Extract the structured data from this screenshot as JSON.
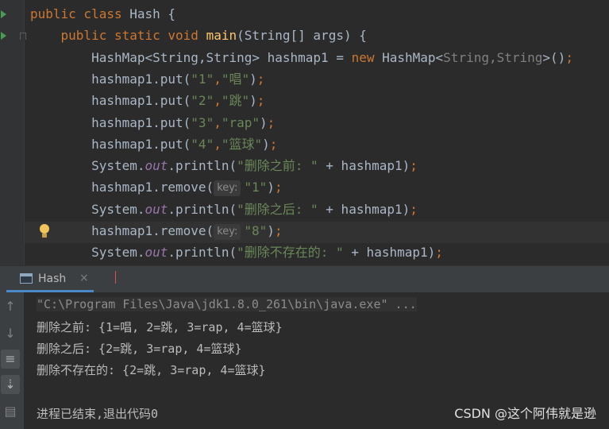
{
  "editor": {
    "lines": [
      {
        "indent": "",
        "parts": [
          [
            "kw",
            "public class "
          ],
          [
            "p",
            "Hash {"
          ]
        ]
      },
      {
        "indent": "    ",
        "parts": [
          [
            "kw",
            "public static void "
          ],
          [
            "fn",
            "main"
          ],
          [
            "p",
            "(String[] args) {"
          ]
        ]
      },
      {
        "indent": "        ",
        "parts": [
          [
            "p",
            "HashMap<String,String> hashmap1 = "
          ],
          [
            "kw",
            "new "
          ],
          [
            "p",
            "HashMap<"
          ],
          [
            "gen",
            "String,String"
          ],
          [
            "p",
            ">()"
          ],
          [
            "kw",
            ";"
          ]
        ]
      },
      {
        "indent": "        ",
        "parts": [
          [
            "p",
            "hashmap1.put("
          ],
          [
            "str",
            "\"1\""
          ],
          [
            "kw",
            ","
          ],
          [
            "str",
            "\"唱\""
          ],
          [
            "p",
            ")"
          ],
          [
            "kw",
            ";"
          ]
        ]
      },
      {
        "indent": "        ",
        "parts": [
          [
            "p",
            "hashmap1.put("
          ],
          [
            "str",
            "\"2\""
          ],
          [
            "kw",
            ","
          ],
          [
            "str",
            "\"跳\""
          ],
          [
            "p",
            ")"
          ],
          [
            "kw",
            ";"
          ]
        ]
      },
      {
        "indent": "        ",
        "parts": [
          [
            "p",
            "hashmap1.put("
          ],
          [
            "str",
            "\"3\""
          ],
          [
            "kw",
            ","
          ],
          [
            "str",
            "\"rap\""
          ],
          [
            "p",
            ")"
          ],
          [
            "kw",
            ";"
          ]
        ]
      },
      {
        "indent": "        ",
        "parts": [
          [
            "p",
            "hashmap1.put("
          ],
          [
            "str",
            "\"4\""
          ],
          [
            "kw",
            ","
          ],
          [
            "str",
            "\"篮球\""
          ],
          [
            "p",
            ")"
          ],
          [
            "kw",
            ";"
          ]
        ]
      },
      {
        "indent": "        ",
        "parts": [
          [
            "p",
            "System."
          ],
          [
            "field",
            "out"
          ],
          [
            "p",
            ".println("
          ],
          [
            "str",
            "\"删除之前: \""
          ],
          [
            "p",
            " + hashmap1)"
          ],
          [
            "kw",
            ";"
          ]
        ]
      },
      {
        "indent": "        ",
        "parts": [
          [
            "p",
            "hashmap1.remove("
          ],
          [
            "hint",
            "key:"
          ],
          [
            "str",
            "\"1\""
          ],
          [
            "p",
            ")"
          ],
          [
            "kw",
            ";"
          ]
        ]
      },
      {
        "indent": "        ",
        "parts": [
          [
            "p",
            "System."
          ],
          [
            "field",
            "out"
          ],
          [
            "p",
            ".println("
          ],
          [
            "str",
            "\"删除之后: \""
          ],
          [
            "p",
            " + hashmap1)"
          ],
          [
            "kw",
            ";"
          ]
        ]
      },
      {
        "indent": "        ",
        "parts": [
          [
            "p",
            "hashmap1.remove("
          ],
          [
            "hint",
            "key:"
          ],
          [
            "str",
            "\"8\""
          ],
          [
            "p",
            ")"
          ],
          [
            "kw",
            ";"
          ]
        ]
      },
      {
        "indent": "        ",
        "parts": [
          [
            "p",
            "System."
          ],
          [
            "field",
            "out"
          ],
          [
            "p",
            ".println("
          ],
          [
            "str",
            "\"删除不存在的: \""
          ],
          [
            "p",
            " + hashmap1)"
          ],
          [
            "kw",
            ";"
          ]
        ]
      }
    ]
  },
  "run_panel": {
    "tab_label": "Hash",
    "tab_close": "×",
    "console_lines": [
      "\"C:\\Program Files\\Java\\jdk1.8.0_261\\bin\\java.exe\" ...",
      "删除之前: {1=唱, 2=跳, 3=rap, 4=篮球}",
      "删除之后: {2=跳, 3=rap, 4=篮球}",
      "删除不存在的: {2=跳, 3=rap, 4=篮球}",
      "",
      "进程已结束,退出代码0"
    ],
    "toolbar_icons": [
      "arrow-up-icon",
      "arrow-down-icon",
      "soft-wrap-icon",
      "scroll-to-end-icon",
      "print-icon"
    ]
  },
  "watermark": "CSDN @这个阿伟就是逊"
}
